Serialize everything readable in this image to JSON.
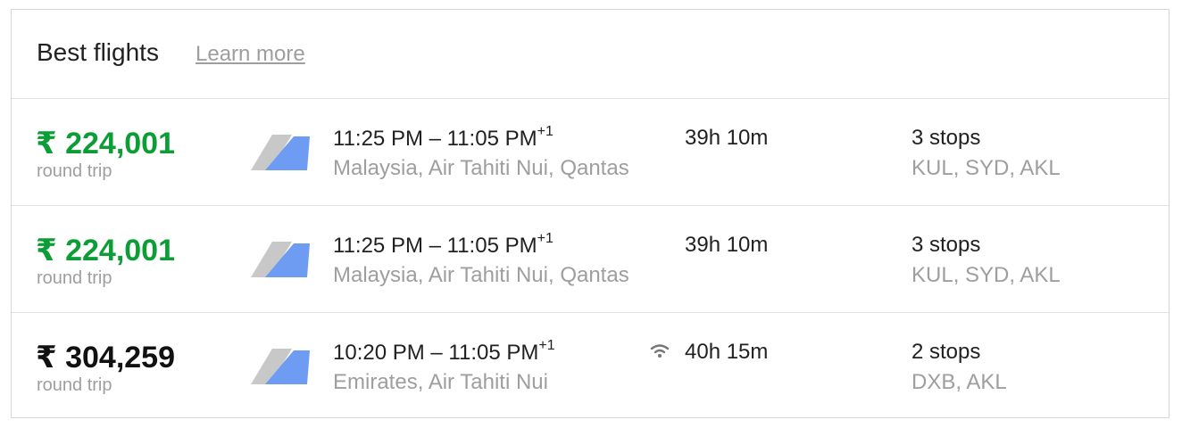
{
  "header": {
    "title": "Best flights",
    "learn_more": "Learn more"
  },
  "flights": [
    {
      "price": "₹ 224,001",
      "price_color": "#0c9d36",
      "trip_type": "round trip",
      "depart": "11:25 PM",
      "separator": " – ",
      "arrive": "11:05 PM",
      "day_offset": "+1",
      "airlines": "Malaysia, Air Tahiti Nui, Qantas",
      "wifi": false,
      "duration": "39h 10m",
      "stops": "3 stops",
      "airports": "KUL, SYD, AKL"
    },
    {
      "price": "₹ 224,001",
      "price_color": "#0c9d36",
      "trip_type": "round trip",
      "depart": "11:25 PM",
      "separator": " – ",
      "arrive": "11:05 PM",
      "day_offset": "+1",
      "airlines": "Malaysia, Air Tahiti Nui, Qantas",
      "wifi": false,
      "duration": "39h 10m",
      "stops": "3 stops",
      "airports": "KUL, SYD, AKL"
    },
    {
      "price": "₹ 304,259",
      "price_color": "#111111",
      "trip_type": "round trip",
      "depart": "10:20 PM",
      "separator": " – ",
      "arrive": "11:05 PM",
      "day_offset": "+1",
      "airlines": "Emirates, Air Tahiti Nui",
      "wifi": true,
      "duration": "40h 15m",
      "stops": "2 stops",
      "airports": "DXB, AKL"
    }
  ],
  "icons": {
    "airline_logo": "multi-airline-tail-icon",
    "wifi": "wifi-icon"
  },
  "colors": {
    "logo_back": "#c8c8c8",
    "logo_front": "#6e9cf3",
    "muted_text": "#9e9e9e"
  }
}
